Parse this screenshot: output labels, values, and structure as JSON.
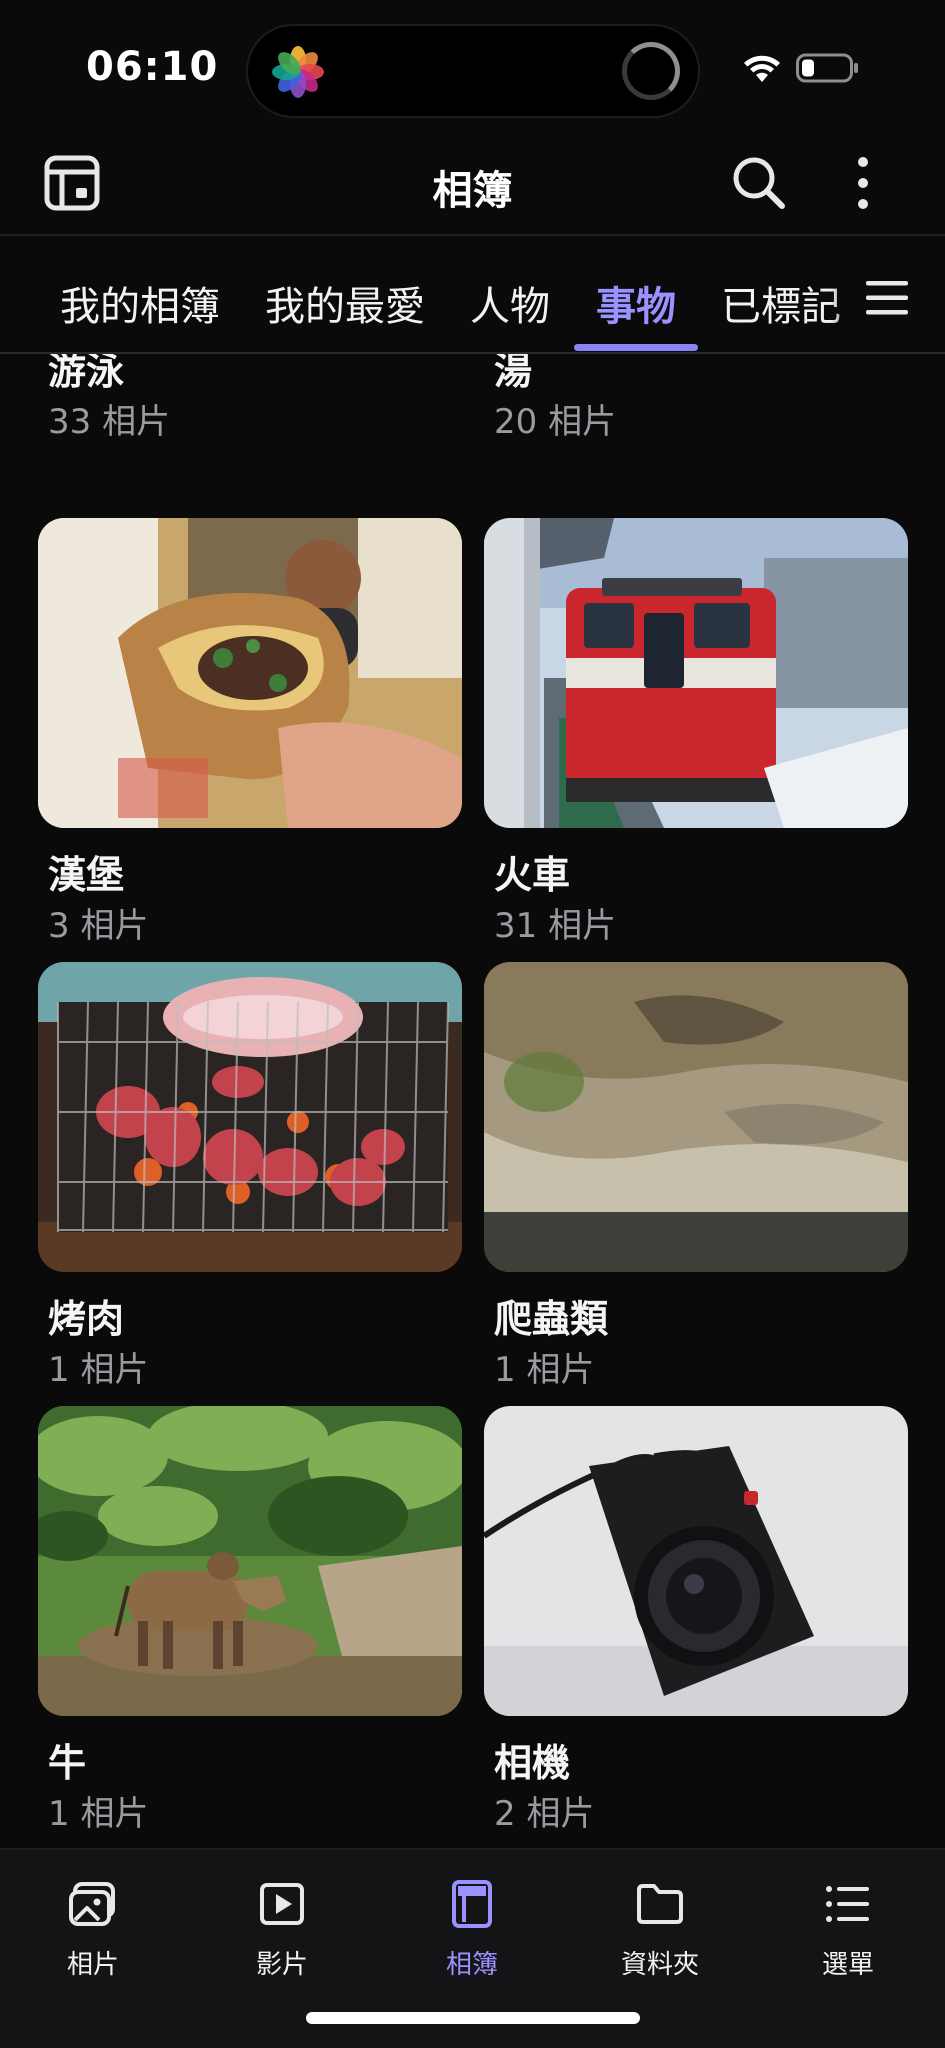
{
  "status_bar": {
    "time": "06:10"
  },
  "app_bar": {
    "title": "相簿"
  },
  "tabs": [
    {
      "label": "我的相簿"
    },
    {
      "label": "我的最愛"
    },
    {
      "label": "人物"
    },
    {
      "label": "事物"
    },
    {
      "label": "已標記"
    }
  ],
  "active_tab": "事物",
  "albums": [
    {
      "title": "游泳",
      "count": "33 相片"
    },
    {
      "title": "湯",
      "count": "20 相片"
    },
    {
      "title": "漢堡",
      "count": "3 相片"
    },
    {
      "title": "火車",
      "count": "31 相片"
    },
    {
      "title": "烤肉",
      "count": "1 相片"
    },
    {
      "title": "爬蟲類",
      "count": "1 相片"
    },
    {
      "title": "牛",
      "count": "1 相片"
    },
    {
      "title": "相機",
      "count": "2 相片"
    }
  ],
  "bottom_nav": [
    {
      "label": "相片",
      "icon": "photos-icon"
    },
    {
      "label": "影片",
      "icon": "video-icon"
    },
    {
      "label": "相簿",
      "icon": "album-icon"
    },
    {
      "label": "資料夾",
      "icon": "folder-icon"
    },
    {
      "label": "選單",
      "icon": "menu-list-icon"
    }
  ],
  "active_nav": "相簿",
  "colors": {
    "accent": "#9a92ff",
    "background": "#0a0a0b",
    "nav_background": "#141416"
  }
}
